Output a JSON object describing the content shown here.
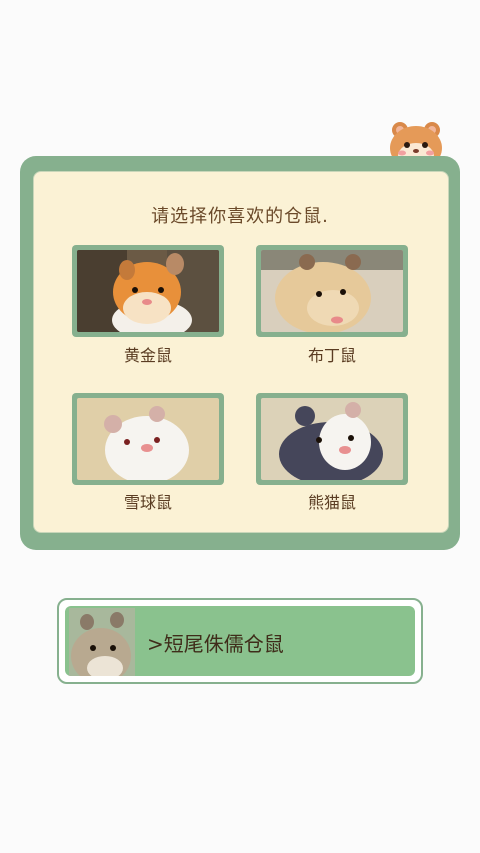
{
  "prompt": "请选择你喜欢的仓鼠.",
  "breeds": [
    {
      "label": "黄金鼠",
      "icon": "golden-hamster-photo"
    },
    {
      "label": "布丁鼠",
      "icon": "pudding-hamster-photo"
    },
    {
      "label": "雪球鼠",
      "icon": "snowball-hamster-photo"
    },
    {
      "label": "熊猫鼠",
      "icon": "panda-hamster-photo"
    }
  ],
  "bottom_option": {
    "label": ">短尾侏儒仓鼠",
    "icon": "dwarf-hamster-photo"
  },
  "colors": {
    "panel": "#86b08e",
    "parchment": "#fbf2d5",
    "option": "#8ac28e",
    "text": "#5a3c22"
  }
}
